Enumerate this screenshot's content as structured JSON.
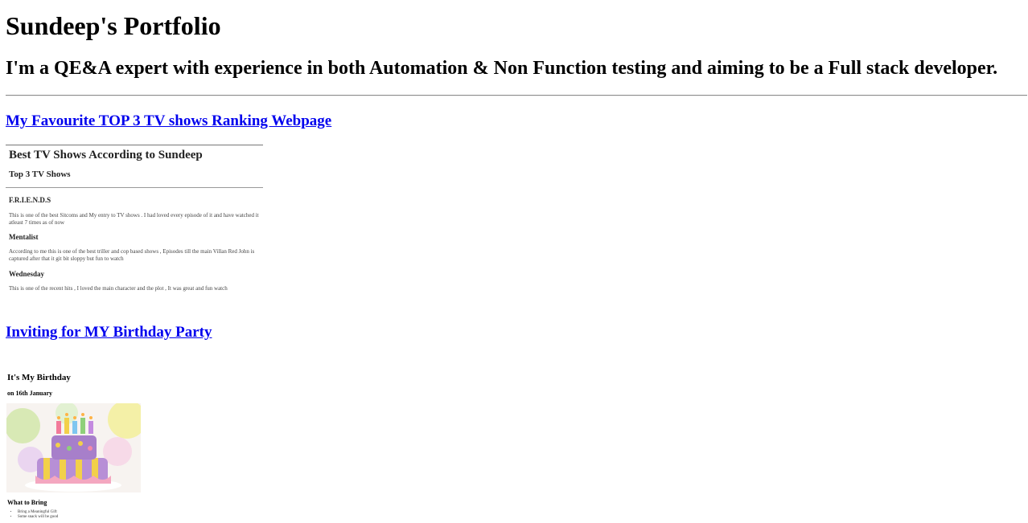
{
  "header": {
    "title": "Sundeep's Portfolio",
    "subtitle": "I'm a QE&A expert with experience in both Automation & Non Function testing and aiming to be a Full stack developer."
  },
  "projects": {
    "tv_shows": {
      "link_label": "My Favourite TOP 3 TV shows Ranking Webpage",
      "preview": {
        "heading": "Best TV Shows According to Sundeep",
        "subheading": "Top 3 TV Shows",
        "shows": [
          {
            "name": "F.R.I.E.N.D.S",
            "description": "This is one of the best Sitcoms and My entry to TV shows . I had loved every episode of it and have watched it atleast 7 times as of now"
          },
          {
            "name": "Mentalist",
            "description": "According to me this is one of the best triller and cop based shows , Episodes till the main Villan Red John is captured after that it git bit sloppy but fun to watch"
          },
          {
            "name": "Wednesday",
            "description": "This is one of the recent hits , I loved the main character and the plot , It was great and fun watch"
          }
        ]
      }
    },
    "birthday": {
      "link_label": "Inviting for MY Birthday Party",
      "preview": {
        "heading": "It's My Birthday",
        "date": "on 16th January",
        "bring_heading": "What to Bring",
        "bring_items": [
          "Bring a Meaningful Gift",
          "Some snack will be good"
        ]
      }
    }
  },
  "colors": {
    "link": "#0000ee",
    "cake_frosting": "#b78fd6",
    "cake_stripe": "#f2d04a",
    "cake_base": "#f4a7c0"
  }
}
